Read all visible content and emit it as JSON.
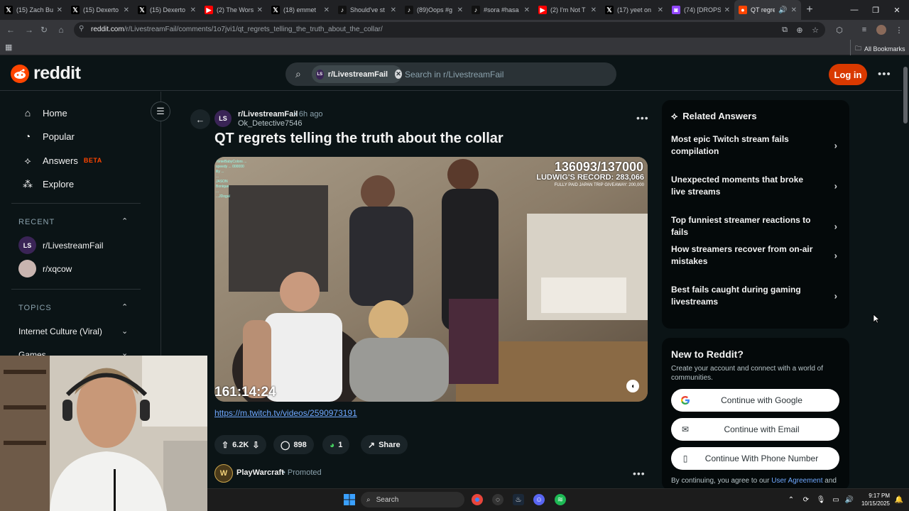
{
  "browser": {
    "tabs": [
      {
        "title": "(15) Zach Bu",
        "icon": "x-logo-icon"
      },
      {
        "title": "(15) Dexerto",
        "icon": "x-logo-icon"
      },
      {
        "title": "(15) Dexerto",
        "icon": "x-logo-icon"
      },
      {
        "title": "(2) The Wors",
        "icon": "youtube-icon"
      },
      {
        "title": "(18) emmet",
        "icon": "x-logo-icon"
      },
      {
        "title": "Should've st",
        "icon": "tiktok-icon"
      },
      {
        "title": "(89)Oops #g",
        "icon": "tiktok-icon"
      },
      {
        "title": "#sora #hasa",
        "icon": "tiktok-icon"
      },
      {
        "title": "(2) I'm Not T",
        "icon": "youtube-icon"
      },
      {
        "title": "(17) yeet on",
        "icon": "x-logo-icon"
      },
      {
        "title": "(74) [DROPS",
        "icon": "twitch-icon"
      },
      {
        "title": "QT regre",
        "icon": "reddit-icon"
      }
    ],
    "url_host": "reddit.com",
    "url_path": "/r/LivestreamFail/comments/1o7jvi1/qt_regrets_telling_the_truth_about_the_collar/",
    "bookmarks_label": "All Bookmarks"
  },
  "header": {
    "logo_text": "reddit",
    "search_chip": "r/LivestreamFail",
    "search_chip_avatar": "LS",
    "search_placeholder": "Search in r/LivestreamFail",
    "login_label": "Log in",
    "brand_color": "#ff4500"
  },
  "sidebar": {
    "items": [
      {
        "label": "Home",
        "icon": "home-icon"
      },
      {
        "label": "Popular",
        "icon": "popular-icon"
      },
      {
        "label": "Answers",
        "icon": "answers-icon",
        "badge": "BETA"
      },
      {
        "label": "Explore",
        "icon": "explore-icon"
      }
    ],
    "recent_label": "RECENT",
    "recent": [
      {
        "label": "r/LivestreamFail",
        "avatar": "LS"
      },
      {
        "label": "r/xqcow",
        "avatar": ""
      }
    ],
    "topics_label": "TOPICS",
    "topics": [
      {
        "label": "Internet Culture (Viral)"
      },
      {
        "label": "Games"
      }
    ]
  },
  "post": {
    "subreddit": "r/LivestreamFail",
    "subreddit_avatar": "LS",
    "time": "• 6h ago",
    "author": "Ok_Detective7546",
    "title": "QT regrets telling the truth about the collar",
    "media": {
      "counter": "136093/137000",
      "record": "LUDWIG'S RECORD: 283,066",
      "giveaway": "FULLY PAID JAPAN TRIP GIVEAWAY: 200,000",
      "timer": "161:14:24",
      "chat_lines": [
        "TonieBabyColors ...",
        "speedy ... 000000",
        "lily ...",
        "...",
        "JASON",
        "Bonique",
        "...",
        "...JDogal"
      ]
    },
    "link": "https://m.twitch.tv/videos/2590973191",
    "votes": "6.2K",
    "comments": "898",
    "awards": "1",
    "share_label": "Share"
  },
  "promo": {
    "name": "PlayWarcraft",
    "tag": "Promoted"
  },
  "related": {
    "title": "Related Answers",
    "items": [
      {
        "label": "Most epic Twitch stream fails compilation"
      },
      {
        "label": "Unexpected moments that broke live streams"
      },
      {
        "label": "Top funniest streamer reactions to fails"
      },
      {
        "label": "How streamers recover from on-air mistakes"
      },
      {
        "label": "Best fails caught during gaming livestreams"
      }
    ]
  },
  "newto": {
    "title": "New to Reddit?",
    "desc": "Create your account and connect with a world of communities.",
    "google": "Continue with Google",
    "email": "Continue with Email",
    "phone": "Continue With Phone Number",
    "agree_text": "By continuing, you agree to our",
    "agree_link": "User Agreement",
    "agree_tail": "and"
  },
  "taskbar": {
    "search_label": "Search",
    "time": "9:17 PM",
    "date": "10/15/2025"
  }
}
